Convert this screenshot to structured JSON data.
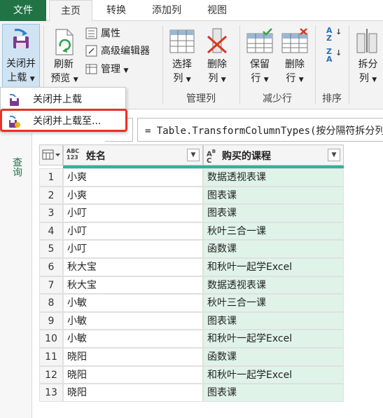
{
  "tabs": {
    "file": "文件",
    "home": "主页",
    "transform": "转换",
    "add_column": "添加列",
    "view": "视图"
  },
  "ribbon": {
    "close_load": {
      "line1": "关闭并",
      "line2": "上载"
    },
    "refresh_preview": {
      "line1": "刷新",
      "line2": "预览"
    },
    "properties": "属性",
    "advanced_editor": "高级编辑器",
    "manage": "管理",
    "choose_columns": {
      "line1": "选择",
      "line2": "列"
    },
    "remove_columns": {
      "line1": "删除",
      "line2": "列"
    },
    "keep_rows": {
      "line1": "保留",
      "line2": "行"
    },
    "remove_rows": {
      "line1": "删除",
      "line2": "行"
    },
    "split": {
      "line1": "拆分",
      "line2": "列"
    },
    "groups": {
      "manage_columns": "管理列",
      "reduce_rows": "减少行",
      "sort": "排序"
    }
  },
  "menu": {
    "close_load": "关闭并上载",
    "close_load_to": "关闭并上载至..."
  },
  "formula_bar": {
    "text": "= Table.TransformColumnTypes(按分隔符拆分列"
  },
  "side_pane": {
    "label": "查询"
  },
  "table": {
    "columns": [
      {
        "title": "姓名",
        "type_badge_top": "ABC",
        "type_badge_bottom": "123"
      },
      {
        "title": "购买的课程",
        "type_badge_top": "A",
        "type_badge_bottom": "C"
      }
    ],
    "rows": [
      {
        "num": "1",
        "name": "小爽",
        "course": "数据透视表课"
      },
      {
        "num": "2",
        "name": "小爽",
        "course": "图表课"
      },
      {
        "num": "3",
        "name": "小叮",
        "course": "图表课"
      },
      {
        "num": "4",
        "name": "小叮",
        "course": "秋叶三合一课"
      },
      {
        "num": "5",
        "name": "小叮",
        "course": "函数课"
      },
      {
        "num": "6",
        "name": "秋大宝",
        "course": "和秋叶一起学Excel"
      },
      {
        "num": "7",
        "name": "秋大宝",
        "course": "数据透视表课"
      },
      {
        "num": "8",
        "name": "小敏",
        "course": "秋叶三合一课"
      },
      {
        "num": "9",
        "name": "小敏",
        "course": "图表课"
      },
      {
        "num": "10",
        "name": "小敏",
        "course": "和秋叶一起学Excel"
      },
      {
        "num": "11",
        "name": "晓阳",
        "course": "函数课"
      },
      {
        "num": "12",
        "name": "晓阳",
        "course": "和秋叶一起学Excel"
      },
      {
        "num": "13",
        "name": "晓阳",
        "course": "图表课"
      }
    ]
  },
  "colors": {
    "accent": "#217346",
    "teal": "#2fb3a0",
    "course_bg": "#e0f3e9",
    "highlight": "#e8312a"
  },
  "icons": [
    "save-icon",
    "refresh-icon",
    "properties-icon",
    "advanced-editor-icon",
    "manage-icon",
    "choose-columns-icon",
    "remove-columns-icon",
    "keep-rows-icon",
    "remove-rows-icon",
    "sort-asc-icon",
    "sort-desc-icon",
    "split-column-icon",
    "table-icon",
    "chevron-down-icon"
  ]
}
